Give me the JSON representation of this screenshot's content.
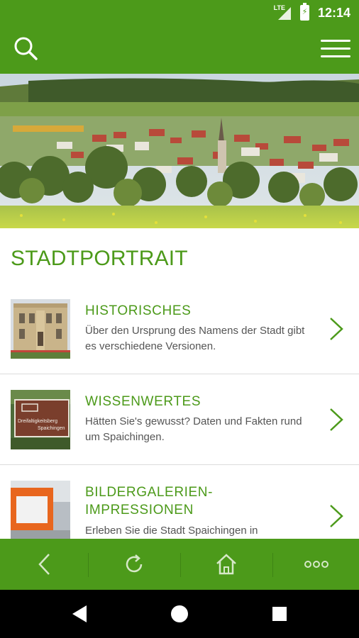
{
  "status": {
    "network": "LTE",
    "time": "12:14"
  },
  "header": {
    "search_icon": "search-icon",
    "menu_icon": "hamburger-menu-icon"
  },
  "section": {
    "title": "STADTPORTRAIT"
  },
  "items": [
    {
      "title": "HISTORISCHES",
      "description": "Über den Ursprung des Namens der Stadt gibt es verschiedene Versionen."
    },
    {
      "title": "WISSENWERTES",
      "description": "Hätten Sie's gewusst? Daten und Fakten rund um Spaichingen."
    },
    {
      "title": "BILDERGALERIEN-IMPRESSIONEN",
      "description": "Erleben Sie die Stadt Spaichingen in"
    }
  ],
  "sign_text": {
    "line1": "Dreifaltigkeitsberg",
    "line2": "Spaichingen"
  },
  "bottom_nav": [
    "back-icon",
    "refresh-icon",
    "home-icon",
    "more-icon"
  ],
  "system_nav": [
    "back-triangle-icon",
    "home-circle-icon",
    "recents-square-icon"
  ],
  "colors": {
    "brand_green": "#4c9a1a",
    "title_green": "#4c9a1a"
  }
}
